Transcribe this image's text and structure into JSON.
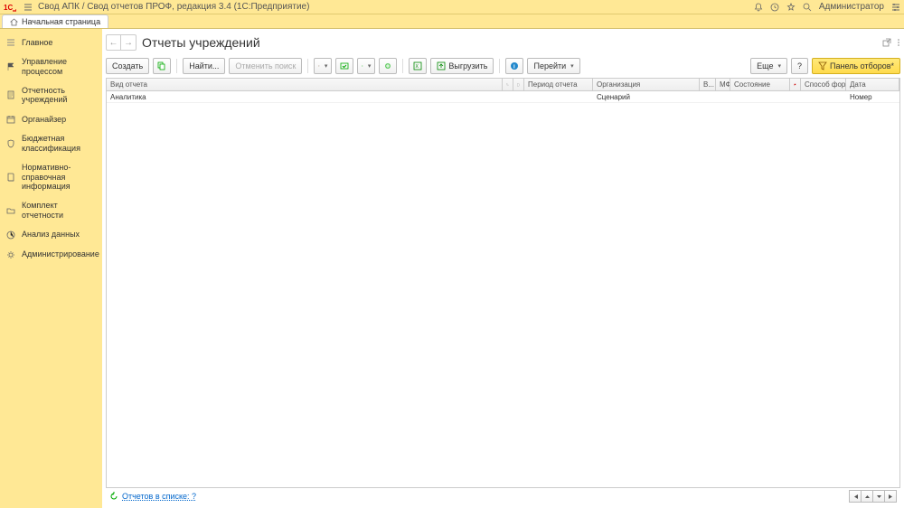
{
  "titlebar": {
    "title": "Свод АПК / Свод отчетов ПРОФ, редакция 3.4  (1С:Предприятие)",
    "user": "Администратор"
  },
  "tab": {
    "label": "Начальная страница"
  },
  "sidebar": {
    "items": [
      {
        "label": "Главное"
      },
      {
        "label": "Управление процессом"
      },
      {
        "label": "Отчетность учреждений"
      },
      {
        "label": "Органайзер"
      },
      {
        "label": "Бюджетная классификация"
      },
      {
        "label": "Нормативно-справочная информация"
      },
      {
        "label": "Комплект отчетности"
      },
      {
        "label": "Анализ данных"
      },
      {
        "label": "Администрирование"
      }
    ]
  },
  "content": {
    "title": "Отчеты учреждений"
  },
  "toolbar": {
    "create": "Создать",
    "find": "Найти...",
    "cancel_find": "Отменить поиск",
    "upload": "Выгрузить",
    "goto": "Перейти",
    "more": "Еще",
    "help": "?",
    "panel": "Панель отборов*"
  },
  "columns": {
    "vid": "Вид отчета",
    "period": "Период отчета",
    "org": "Организация",
    "v": "В...",
    "mf": "МФ",
    "state": "Состояние",
    "sposob": "Способ форм...",
    "date": "Дата"
  },
  "rows": [
    {
      "vid": "Аналитика",
      "org": "Сценарий",
      "date": "Номер"
    }
  ],
  "bottom": {
    "link": "Отчетов в списке: ?"
  }
}
